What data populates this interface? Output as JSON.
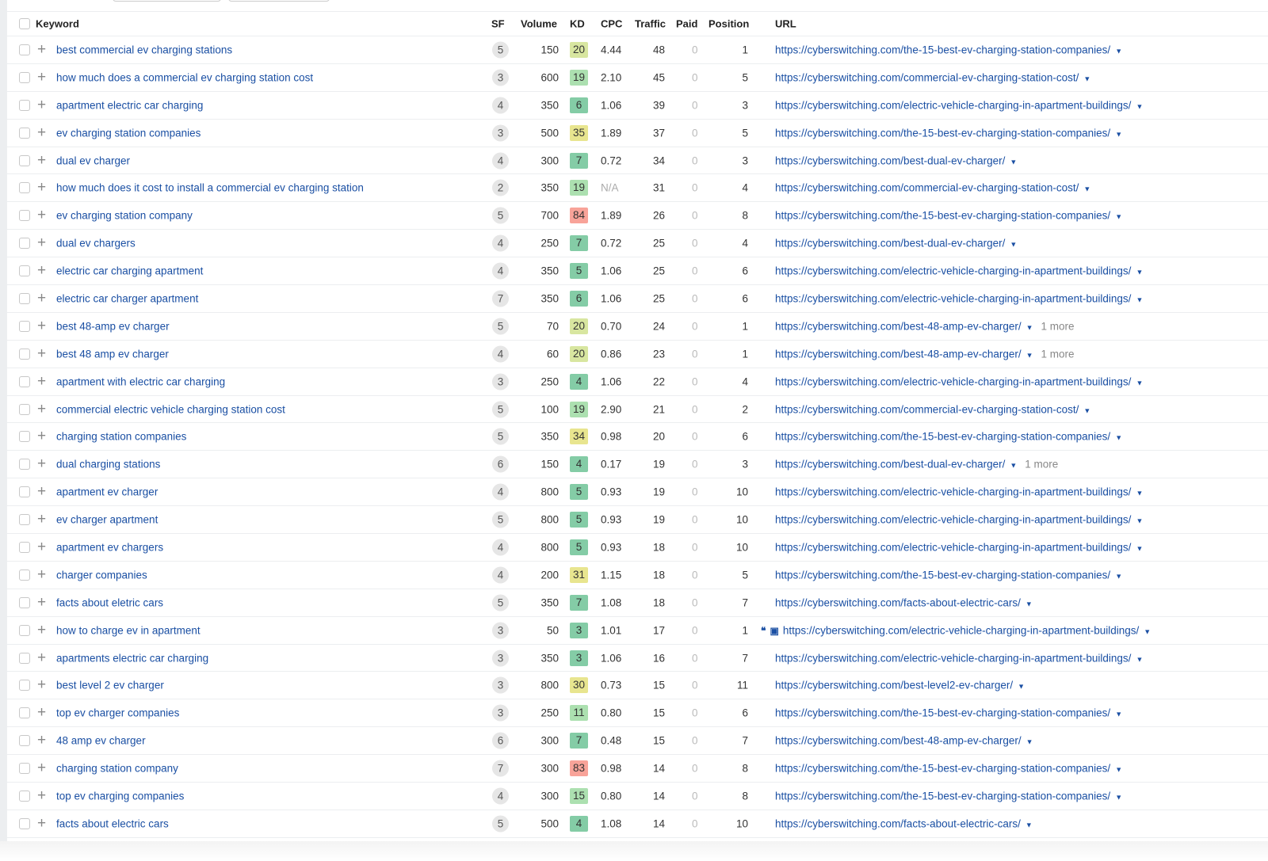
{
  "headers": {
    "keyword": "Keyword",
    "sf": "SF",
    "volume": "Volume",
    "kd": "KD",
    "cpc": "CPC",
    "traffic": "Traffic",
    "paid": "Paid",
    "position": "Position",
    "url": "URL"
  },
  "kd_colors": {
    "very_easy": "#84cca6",
    "easy": "#ace0b0",
    "medium_easy": "#d8e6a0",
    "medium": "#e8e58f",
    "hard": "#f8a399"
  },
  "rows": [
    {
      "keyword": "best commercial ev charging stations",
      "sf": "5",
      "volume": "150",
      "kd": "20",
      "cpc": "4.44",
      "traffic": "48",
      "paid": "0",
      "position": "1",
      "url": "https://cyberswitching.com/the-15-best-ev-charging-station-companies/"
    },
    {
      "keyword": "how much does a commercial ev charging station cost",
      "sf": "3",
      "volume": "600",
      "kd": "19",
      "cpc": "2.10",
      "traffic": "45",
      "paid": "0",
      "position": "5",
      "url": "https://cyberswitching.com/commercial-ev-charging-station-cost/"
    },
    {
      "keyword": "apartment electric car charging",
      "sf": "4",
      "volume": "350",
      "kd": "6",
      "cpc": "1.06",
      "traffic": "39",
      "paid": "0",
      "position": "3",
      "url": "https://cyberswitching.com/electric-vehicle-charging-in-apartment-buildings/"
    },
    {
      "keyword": "ev charging station companies",
      "sf": "3",
      "volume": "500",
      "kd": "35",
      "cpc": "1.89",
      "traffic": "37",
      "paid": "0",
      "position": "5",
      "url": "https://cyberswitching.com/the-15-best-ev-charging-station-companies/"
    },
    {
      "keyword": "dual ev charger",
      "sf": "4",
      "volume": "300",
      "kd": "7",
      "cpc": "0.72",
      "traffic": "34",
      "paid": "0",
      "position": "3",
      "url": "https://cyberswitching.com/best-dual-ev-charger/"
    },
    {
      "keyword": "how much does it cost to install a commercial ev charging station",
      "sf": "2",
      "volume": "350",
      "kd": "19",
      "cpc": "N/A",
      "traffic": "31",
      "paid": "0",
      "position": "4",
      "url": "https://cyberswitching.com/commercial-ev-charging-station-cost/"
    },
    {
      "keyword": "ev charging station company",
      "sf": "5",
      "volume": "700",
      "kd": "84",
      "cpc": "1.89",
      "traffic": "26",
      "paid": "0",
      "position": "8",
      "url": "https://cyberswitching.com/the-15-best-ev-charging-station-companies/"
    },
    {
      "keyword": "dual ev chargers",
      "sf": "4",
      "volume": "250",
      "kd": "7",
      "cpc": "0.72",
      "traffic": "25",
      "paid": "0",
      "position": "4",
      "url": "https://cyberswitching.com/best-dual-ev-charger/"
    },
    {
      "keyword": "electric car charging apartment",
      "sf": "4",
      "volume": "350",
      "kd": "5",
      "cpc": "1.06",
      "traffic": "25",
      "paid": "0",
      "position": "6",
      "url": "https://cyberswitching.com/electric-vehicle-charging-in-apartment-buildings/"
    },
    {
      "keyword": "electric car charger apartment",
      "sf": "7",
      "volume": "350",
      "kd": "6",
      "cpc": "1.06",
      "traffic": "25",
      "paid": "0",
      "position": "6",
      "url": "https://cyberswitching.com/electric-vehicle-charging-in-apartment-buildings/"
    },
    {
      "keyword": "best 48-amp ev charger",
      "sf": "5",
      "volume": "70",
      "kd": "20",
      "cpc": "0.70",
      "traffic": "24",
      "paid": "0",
      "position": "1",
      "url": "https://cyberswitching.com/best-48-amp-ev-charger/",
      "more": "1 more"
    },
    {
      "keyword": "best 48 amp ev charger",
      "sf": "4",
      "volume": "60",
      "kd": "20",
      "cpc": "0.86",
      "traffic": "23",
      "paid": "0",
      "position": "1",
      "url": "https://cyberswitching.com/best-48-amp-ev-charger/",
      "more": "1 more"
    },
    {
      "keyword": "apartment with electric car charging",
      "sf": "3",
      "volume": "250",
      "kd": "4",
      "cpc": "1.06",
      "traffic": "22",
      "paid": "0",
      "position": "4",
      "url": "https://cyberswitching.com/electric-vehicle-charging-in-apartment-buildings/"
    },
    {
      "keyword": "commercial electric vehicle charging station cost",
      "sf": "5",
      "volume": "100",
      "kd": "19",
      "cpc": "2.90",
      "traffic": "21",
      "paid": "0",
      "position": "2",
      "url": "https://cyberswitching.com/commercial-ev-charging-station-cost/"
    },
    {
      "keyword": "charging station companies",
      "sf": "5",
      "volume": "350",
      "kd": "34",
      "cpc": "0.98",
      "traffic": "20",
      "paid": "0",
      "position": "6",
      "url": "https://cyberswitching.com/the-15-best-ev-charging-station-companies/"
    },
    {
      "keyword": "dual charging stations",
      "sf": "6",
      "volume": "150",
      "kd": "4",
      "cpc": "0.17",
      "traffic": "19",
      "paid": "0",
      "position": "3",
      "url": "https://cyberswitching.com/best-dual-ev-charger/",
      "more": "1 more"
    },
    {
      "keyword": "apartment ev charger",
      "sf": "4",
      "volume": "800",
      "kd": "5",
      "cpc": "0.93",
      "traffic": "19",
      "paid": "0",
      "position": "10",
      "url": "https://cyberswitching.com/electric-vehicle-charging-in-apartment-buildings/"
    },
    {
      "keyword": "ev charger apartment",
      "sf": "5",
      "volume": "800",
      "kd": "5",
      "cpc": "0.93",
      "traffic": "19",
      "paid": "0",
      "position": "10",
      "url": "https://cyberswitching.com/electric-vehicle-charging-in-apartment-buildings/"
    },
    {
      "keyword": "apartment ev chargers",
      "sf": "4",
      "volume": "800",
      "kd": "5",
      "cpc": "0.93",
      "traffic": "18",
      "paid": "0",
      "position": "10",
      "url": "https://cyberswitching.com/electric-vehicle-charging-in-apartment-buildings/"
    },
    {
      "keyword": "charger companies",
      "sf": "4",
      "volume": "200",
      "kd": "31",
      "cpc": "1.15",
      "traffic": "18",
      "paid": "0",
      "position": "5",
      "url": "https://cyberswitching.com/the-15-best-ev-charging-station-companies/"
    },
    {
      "keyword": "facts about eletric cars",
      "sf": "5",
      "volume": "350",
      "kd": "7",
      "cpc": "1.08",
      "traffic": "18",
      "paid": "0",
      "position": "7",
      "url": "https://cyberswitching.com/facts-about-electric-cars/"
    },
    {
      "keyword": "how to charge ev in apartment",
      "sf": "3",
      "volume": "50",
      "kd": "3",
      "cpc": "1.01",
      "traffic": "17",
      "paid": "0",
      "position": "1",
      "url": "https://cyberswitching.com/electric-vehicle-charging-in-apartment-buildings/",
      "serp_icons": true
    },
    {
      "keyword": "apartments electric car charging",
      "sf": "3",
      "volume": "350",
      "kd": "3",
      "cpc": "1.06",
      "traffic": "16",
      "paid": "0",
      "position": "7",
      "url": "https://cyberswitching.com/electric-vehicle-charging-in-apartment-buildings/"
    },
    {
      "keyword": "best level 2 ev charger",
      "sf": "3",
      "volume": "800",
      "kd": "30",
      "cpc": "0.73",
      "traffic": "15",
      "paid": "0",
      "position": "11",
      "url": "https://cyberswitching.com/best-level2-ev-charger/"
    },
    {
      "keyword": "top ev charger companies",
      "sf": "3",
      "volume": "250",
      "kd": "11",
      "cpc": "0.80",
      "traffic": "15",
      "paid": "0",
      "position": "6",
      "url": "https://cyberswitching.com/the-15-best-ev-charging-station-companies/"
    },
    {
      "keyword": "48 amp ev charger",
      "sf": "6",
      "volume": "300",
      "kd": "7",
      "cpc": "0.48",
      "traffic": "15",
      "paid": "0",
      "position": "7",
      "url": "https://cyberswitching.com/best-48-amp-ev-charger/"
    },
    {
      "keyword": "charging station company",
      "sf": "7",
      "volume": "300",
      "kd": "83",
      "cpc": "0.98",
      "traffic": "14",
      "paid": "0",
      "position": "8",
      "url": "https://cyberswitching.com/the-15-best-ev-charging-station-companies/"
    },
    {
      "keyword": "top ev charging companies",
      "sf": "4",
      "volume": "300",
      "kd": "15",
      "cpc": "0.80",
      "traffic": "14",
      "paid": "0",
      "position": "8",
      "url": "https://cyberswitching.com/the-15-best-ev-charging-station-companies/"
    },
    {
      "keyword": "facts about electric cars",
      "sf": "5",
      "volume": "500",
      "kd": "4",
      "cpc": "1.08",
      "traffic": "14",
      "paid": "0",
      "position": "10",
      "url": "https://cyberswitching.com/facts-about-electric-cars/"
    }
  ]
}
